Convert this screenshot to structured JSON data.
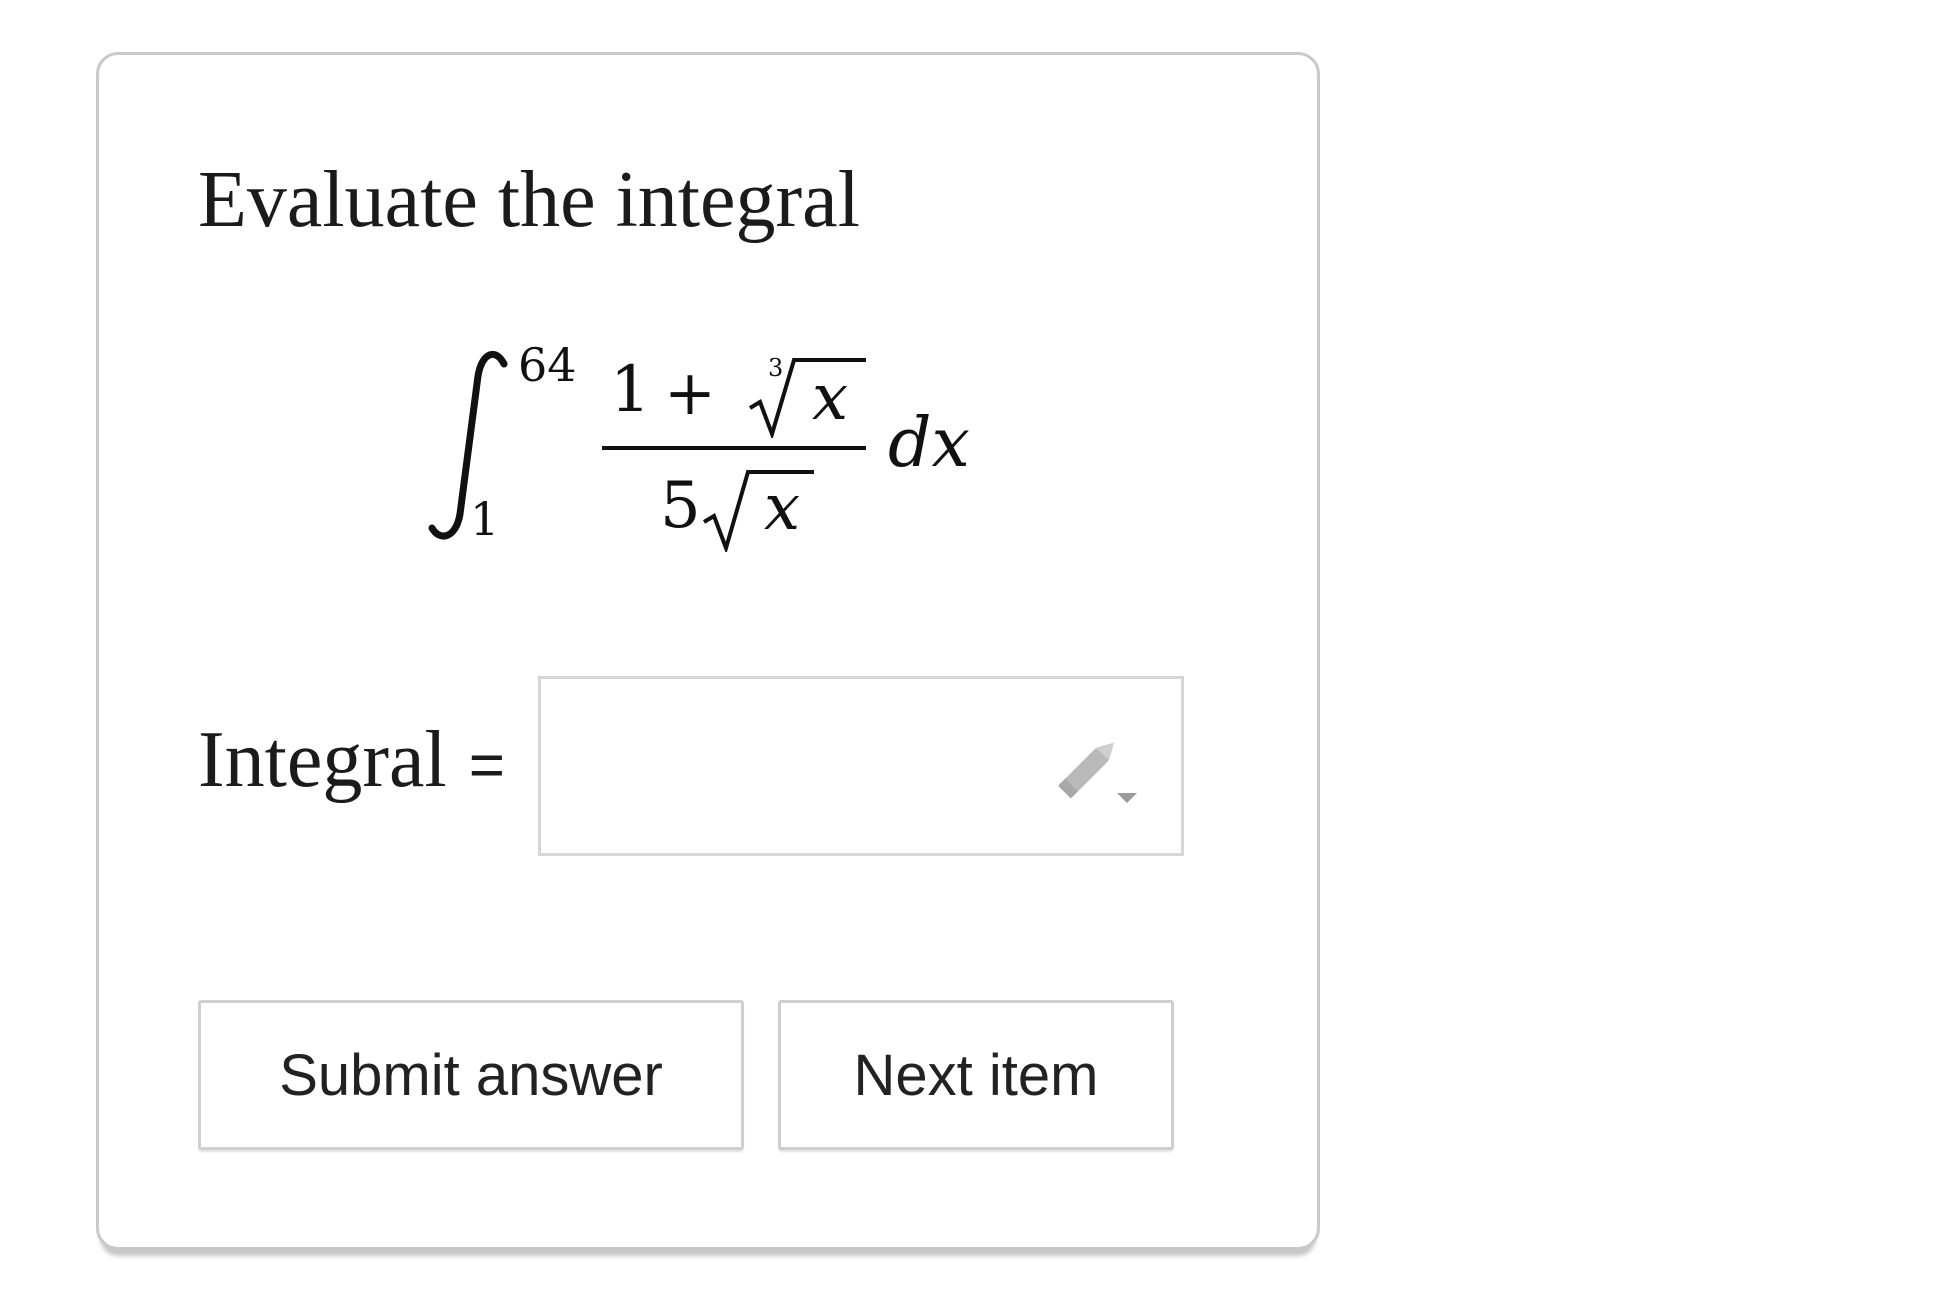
{
  "question": {
    "prompt": "Evaluate the integral",
    "integral": {
      "lower_limit": "1",
      "upper_limit": "64",
      "numerator_constant": "1",
      "numerator_operator": "+",
      "cube_root_index": "3",
      "numerator_variable": "x",
      "denominator_coefficient": "5",
      "denominator_variable": "x",
      "differential": "dx"
    }
  },
  "answer": {
    "label": "Integral",
    "equals": "=",
    "value": "",
    "icon": "pencil-icon"
  },
  "buttons": {
    "submit_label": "Submit answer",
    "next_label": "Next item"
  }
}
